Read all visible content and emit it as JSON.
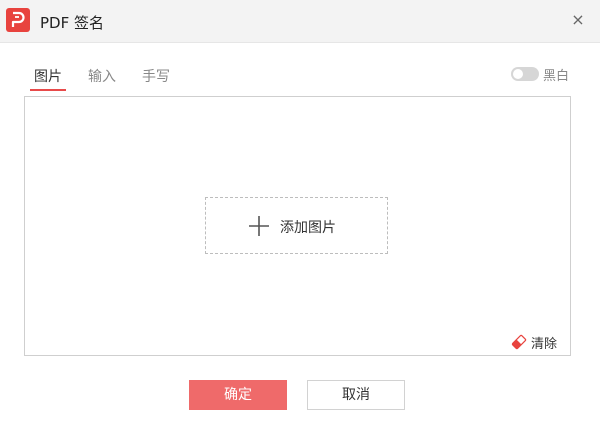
{
  "window": {
    "title": "PDF 签名",
    "close_glyph": "×",
    "logo_icon": "pdf-app-logo",
    "accent_color": "#e8433e"
  },
  "tabs": [
    {
      "label": "图片",
      "active": true
    },
    {
      "label": "输入",
      "active": false
    },
    {
      "label": "手写",
      "active": false
    }
  ],
  "bw_toggle": {
    "label": "黑白",
    "on": false
  },
  "canvas": {
    "add_image_label": "添加图片",
    "add_icon": "plus-icon",
    "clear_label": "清除",
    "clear_icon": "eraser-icon"
  },
  "buttons": {
    "confirm": "确定",
    "cancel": "取消",
    "primary_color": "#ef6a6a"
  }
}
